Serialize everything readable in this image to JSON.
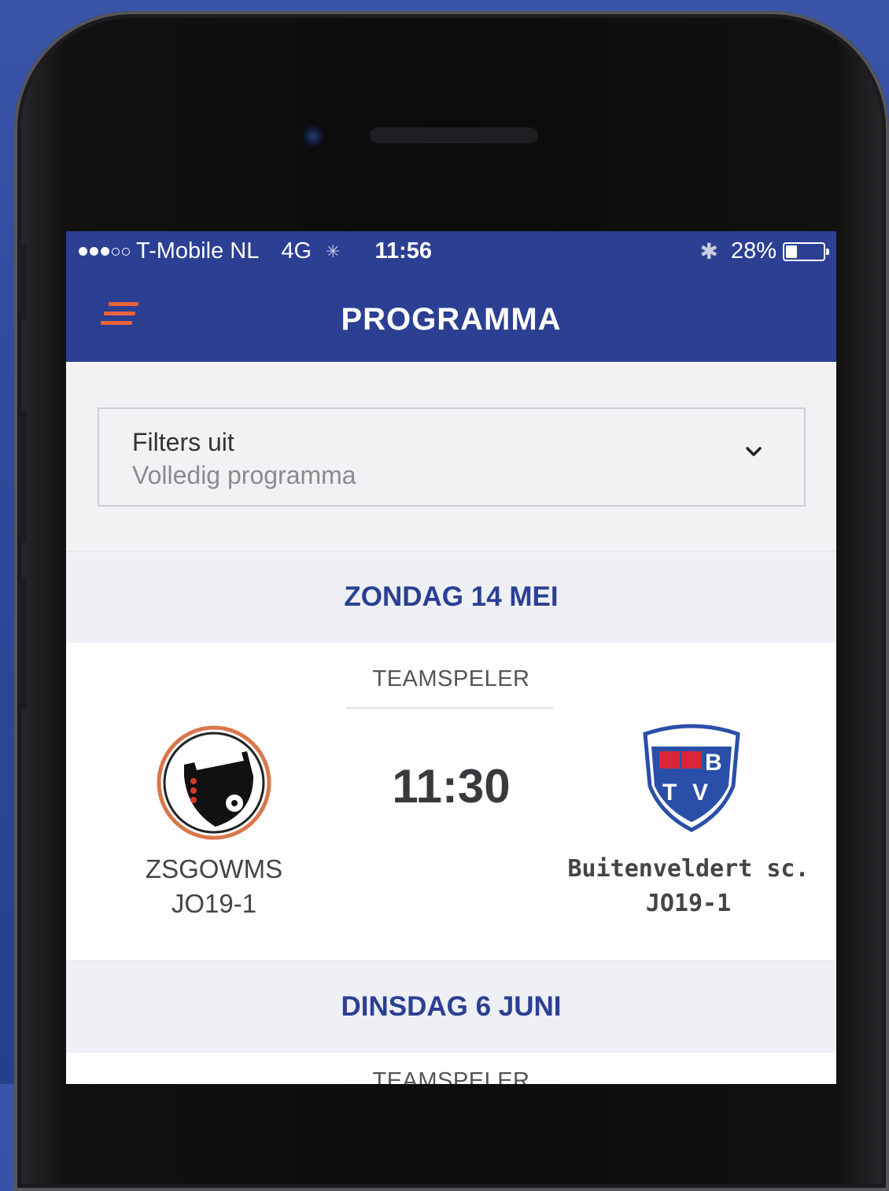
{
  "status_bar": {
    "carrier": "T-Mobile NL",
    "network": "4G",
    "time": "11:56",
    "battery": "28%",
    "battery_level": 0.28,
    "signal_bars": 3,
    "signal_total": 5
  },
  "nav": {
    "title": "PROGRAMMA",
    "menu_icon": "hamburger-menu-icon"
  },
  "filter": {
    "title": "Filters uit",
    "subtitle": "Volledig programma",
    "icon": "chevron-down-icon"
  },
  "days": [
    {
      "label": "ZONDAG 14 MEI",
      "matches": [
        {
          "category": "TEAMSPELER",
          "time": "11:30",
          "home": {
            "name": "ZSGOWMS",
            "team": "JO19-1"
          },
          "away": {
            "name": "Buitenveldert sc.",
            "team": "JO19-1"
          }
        }
      ]
    },
    {
      "label": "DINSDAG 6 JUNI",
      "matches": [
        {
          "category": "TEAMSPELER"
        }
      ]
    }
  ],
  "colors": {
    "brand_blue": "#2b3f93",
    "accent_orange": "#e8643a"
  }
}
